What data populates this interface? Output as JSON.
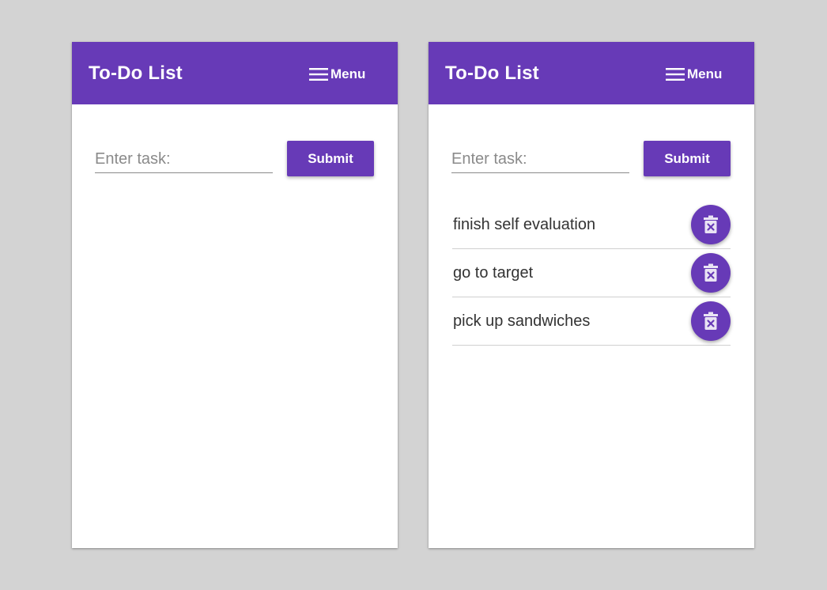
{
  "colors": {
    "background": "#d3d3d3",
    "primary": "#673ab7",
    "panel": "#ffffff",
    "text": "#333333"
  },
  "panels": [
    {
      "app_title": "To-Do List",
      "menu": {
        "icon": "hamburger-menu-icon",
        "label": "Menu"
      },
      "input": {
        "placeholder": "Enter task:",
        "value": ""
      },
      "submit_label": "Submit",
      "tasks": []
    },
    {
      "app_title": "To-Do List",
      "menu": {
        "icon": "hamburger-menu-icon",
        "label": "Menu"
      },
      "input": {
        "placeholder": "Enter task:",
        "value": ""
      },
      "submit_label": "Submit",
      "tasks": [
        {
          "text": "finish self evaluation",
          "action_icon": "trash-delete-icon"
        },
        {
          "text": "go to target",
          "action_icon": "trash-delete-icon"
        },
        {
          "text": "pick up sandwiches",
          "action_icon": "trash-delete-icon"
        }
      ]
    }
  ]
}
